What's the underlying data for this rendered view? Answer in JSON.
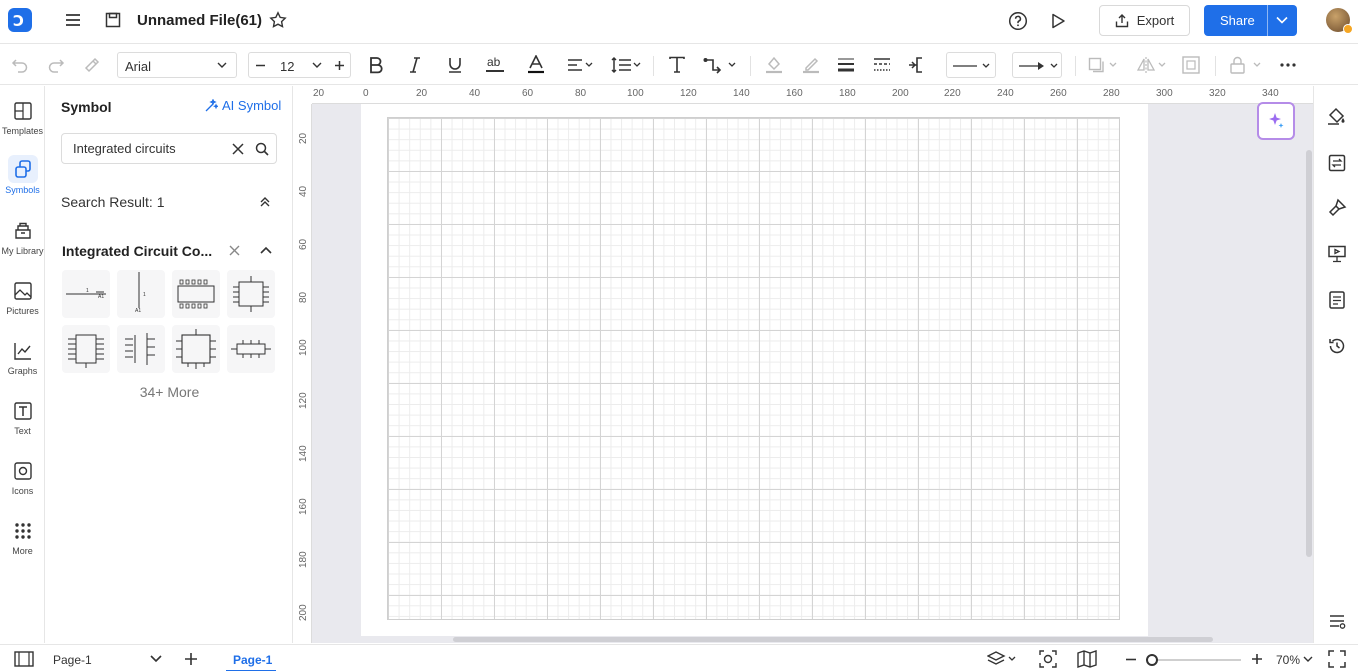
{
  "app": {
    "file_title": "Unnamed File(61)",
    "export_label": "Export",
    "share_label": "Share"
  },
  "toolbar": {
    "font_family": "Arial",
    "font_size": "12"
  },
  "rail": [
    {
      "label": "Templates",
      "icon": "templates-icon"
    },
    {
      "label": "Symbols",
      "icon": "symbols-icon",
      "active": true
    },
    {
      "label": "My Library",
      "icon": "library-icon"
    },
    {
      "label": "Pictures",
      "icon": "pictures-icon"
    },
    {
      "label": "Graphs",
      "icon": "graphs-icon"
    },
    {
      "label": "Text",
      "icon": "text-icon"
    },
    {
      "label": "Icons",
      "icon": "icons-icon"
    },
    {
      "label": "More",
      "icon": "more-icon"
    }
  ],
  "panel": {
    "title": "Symbol",
    "ai_symbol_label": "AI Symbol",
    "search_value": "Integrated circuits",
    "result_label": "Search Result: 1",
    "category_title": "Integrated Circuit Co...",
    "more_label": "34+ More"
  },
  "ruler": {
    "h_labels": [
      "20",
      "0",
      "20",
      "40",
      "60",
      "80",
      "100",
      "120",
      "140",
      "160",
      "180",
      "200",
      "220",
      "240",
      "260",
      "280",
      "300",
      "320",
      "340"
    ],
    "v_labels": [
      "20",
      "40",
      "60",
      "80",
      "100",
      "120",
      "140",
      "160",
      "180",
      "200"
    ]
  },
  "bottom": {
    "page_select": "Page-1",
    "page_tab": "Page-1",
    "zoom": "70%"
  },
  "colors": {
    "accent": "#1f6fe8",
    "ai_border": "#b58ce8"
  }
}
